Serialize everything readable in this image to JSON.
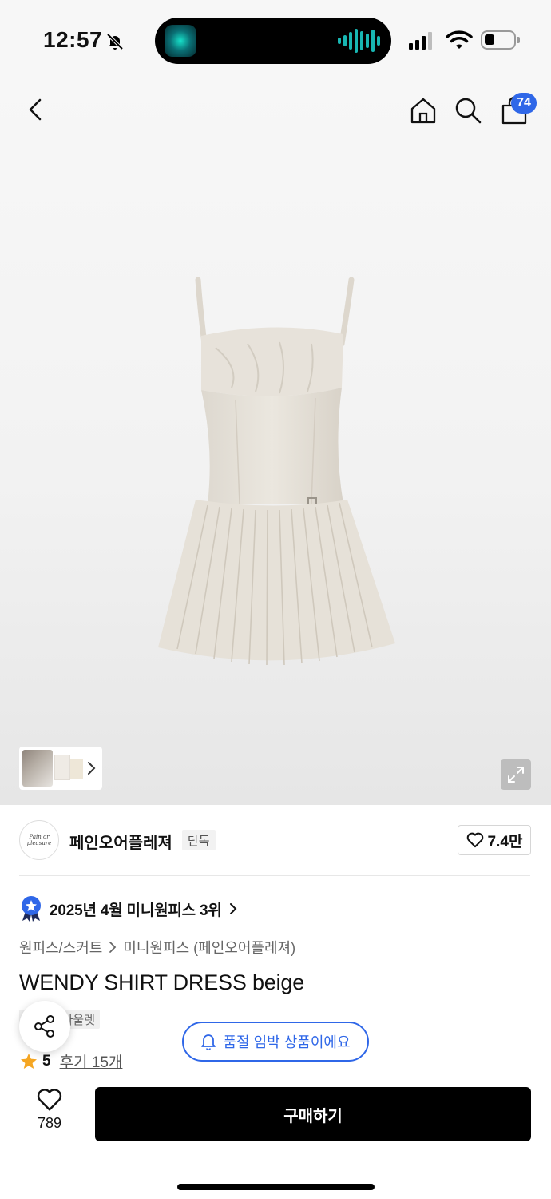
{
  "status_bar": {
    "time": "12:57"
  },
  "header": {
    "cart_count": "74"
  },
  "brand": {
    "logo_text": "Pain or pleasure",
    "name": "페인오어플레져",
    "tag": "단독",
    "like_count": "7.4만"
  },
  "ranking": {
    "text": "2025년 4월 미니원피스 3위"
  },
  "breadcrumb": {
    "category": "원피스/스커트",
    "subcategory": "미니원피스 (페인오어플레져)"
  },
  "product": {
    "title": "WENDY SHIRT DRESS beige",
    "tags": [
      "단독",
      "아울렛"
    ],
    "rating": "5",
    "reviews": "후기 15개"
  },
  "soldout_notice": "품절 임박 상품이에요",
  "bottom": {
    "wish_count": "789",
    "buy_label": "구매하기"
  },
  "colors": {
    "accent": "#2f67e8",
    "star": "#f5a623",
    "buy_button": "#000000"
  }
}
